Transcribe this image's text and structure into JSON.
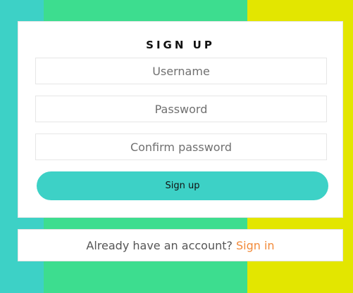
{
  "colors": {
    "stripe_left": "#3dd1c6",
    "stripe_middle": "#3ddd8f",
    "stripe_right": "#e3e600",
    "button_bg": "#3dd1c6",
    "link": "#f28a3a"
  },
  "signup": {
    "title": "SIGN UP",
    "username_placeholder": "Username",
    "password_placeholder": "Password",
    "confirm_placeholder": "Confirm password",
    "button_label": "Sign up"
  },
  "signin": {
    "prompt": "Already have an account?",
    "link_label": "Sign in"
  }
}
